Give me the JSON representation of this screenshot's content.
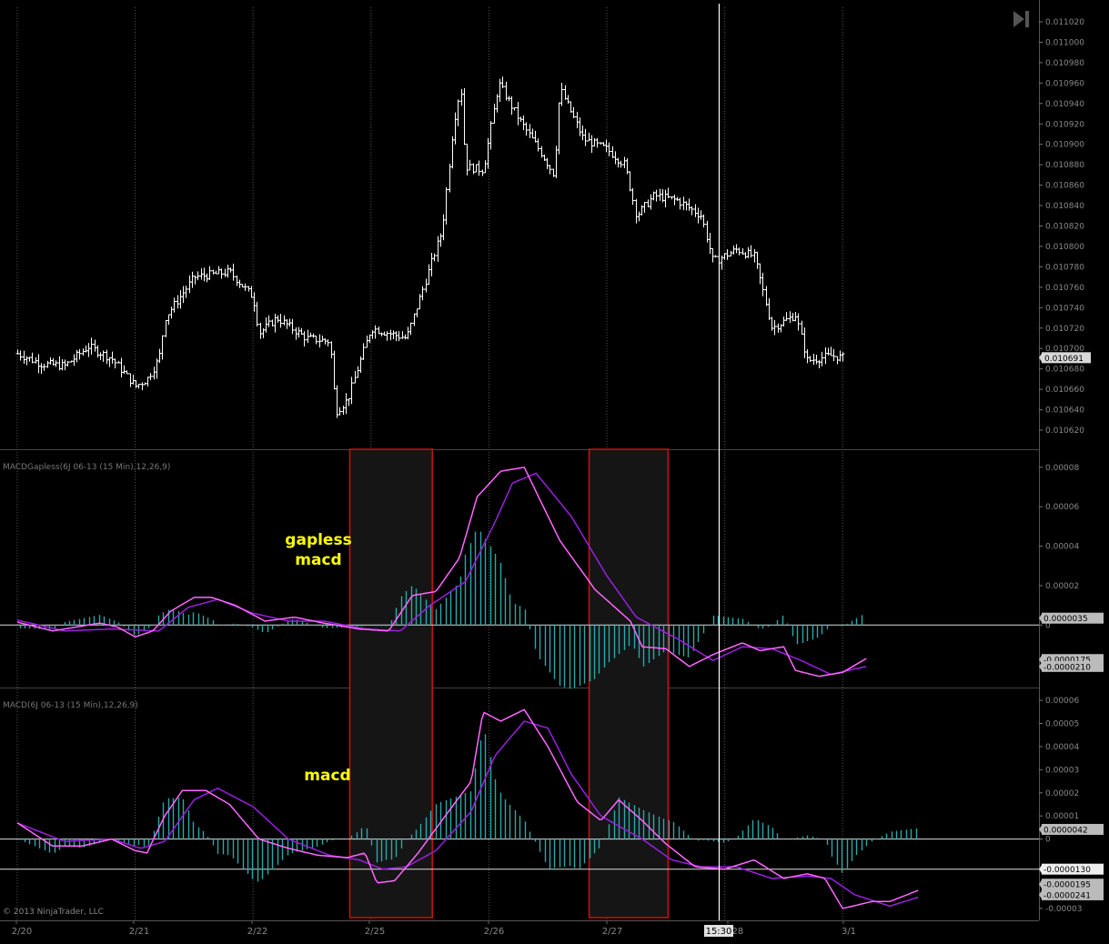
{
  "chart_data": [
    {
      "type": "line",
      "panel": "price",
      "title": "",
      "ylim": [
        0.0106,
        0.01103
      ],
      "yticks": [
        "0.011020",
        "0.011000",
        "0.010980",
        "0.010960",
        "0.010940",
        "0.010920",
        "0.010900",
        "0.010880",
        "0.010860",
        "0.010840",
        "0.010820",
        "0.010800",
        "0.010780",
        "0.010760",
        "0.010740",
        "0.010720",
        "0.010700",
        "0.010680",
        "0.010660",
        "0.010640",
        "0.010620"
      ],
      "last_price_label": "0.010691",
      "anchors": [
        {
          "t": 0.0,
          "p": 0.010695
        },
        {
          "t": 0.2,
          "p": 0.010685
        },
        {
          "t": 0.4,
          "p": 0.010683
        },
        {
          "t": 0.6,
          "p": 0.010702
        },
        {
          "t": 0.8,
          "p": 0.01069
        },
        {
          "t": 1.0,
          "p": 0.010663
        },
        {
          "t": 1.1,
          "p": 0.01067
        },
        {
          "t": 1.2,
          "p": 0.01069
        },
        {
          "t": 1.25,
          "p": 0.01073
        },
        {
          "t": 1.5,
          "p": 0.01077
        },
        {
          "t": 1.8,
          "p": 0.010775
        },
        {
          "t": 2.0,
          "p": 0.01075
        },
        {
          "t": 2.05,
          "p": 0.010715
        },
        {
          "t": 2.2,
          "p": 0.01073
        },
        {
          "t": 2.45,
          "p": 0.01071
        },
        {
          "t": 2.65,
          "p": 0.010707
        },
        {
          "t": 2.7,
          "p": 0.010638
        },
        {
          "t": 2.8,
          "p": 0.01065
        },
        {
          "t": 3.0,
          "p": 0.01072
        },
        {
          "t": 3.3,
          "p": 0.01071
        },
        {
          "t": 3.5,
          "p": 0.01078
        },
        {
          "t": 3.6,
          "p": 0.010815
        },
        {
          "t": 3.7,
          "p": 0.01092
        },
        {
          "t": 3.76,
          "p": 0.010958
        },
        {
          "t": 3.8,
          "p": 0.010878
        },
        {
          "t": 3.95,
          "p": 0.010875
        },
        {
          "t": 4.08,
          "p": 0.01096
        },
        {
          "t": 4.25,
          "p": 0.010925
        },
        {
          "t": 4.45,
          "p": 0.01089
        },
        {
          "t": 4.55,
          "p": 0.01087
        },
        {
          "t": 4.6,
          "p": 0.010955
        },
        {
          "t": 4.8,
          "p": 0.010905
        },
        {
          "t": 5.0,
          "p": 0.010895
        },
        {
          "t": 5.15,
          "p": 0.01088
        },
        {
          "t": 5.25,
          "p": 0.01083
        },
        {
          "t": 5.4,
          "p": 0.01085
        },
        {
          "t": 5.6,
          "p": 0.010845
        },
        {
          "t": 5.8,
          "p": 0.01083
        },
        {
          "t": 5.9,
          "p": 0.010785
        },
        {
          "t": 6.1,
          "p": 0.010797
        },
        {
          "t": 6.25,
          "p": 0.01079
        },
        {
          "t": 6.4,
          "p": 0.01072
        },
        {
          "t": 6.6,
          "p": 0.010733
        },
        {
          "t": 6.7,
          "p": 0.010688
        },
        {
          "t": 6.9,
          "p": 0.010693
        },
        {
          "t": 7.0,
          "p": 0.010691
        }
      ]
    },
    {
      "type": "line",
      "panel": "gapless",
      "title": "MACDGapless(6J 06-13 (15 Min),12,26,9)",
      "annotation": [
        "gapless",
        "macd"
      ],
      "ylim": [
        -2.8e-05,
        8.5e-05
      ],
      "yticks": [
        {
          "v": 8e-05,
          "label": "0.00008"
        },
        {
          "v": 6e-05,
          "label": "0.00006"
        },
        {
          "v": 4e-05,
          "label": "0.00004"
        },
        {
          "v": 2e-05,
          "label": "0.00002"
        },
        {
          "v": 0.0,
          "label": "0"
        }
      ],
      "reference_value": 0.0,
      "value_badges": [
        {
          "v": 3.5e-06,
          "label": "0.0000035"
        },
        {
          "v": -1.75e-05,
          "label": "-0.0000175"
        },
        {
          "v": -2.1e-05,
          "label": "-0.0000210"
        }
      ],
      "series": [
        {
          "color": "#ff66ff",
          "points": [
            [
              0,
              1.5e-06
            ],
            [
              0.3,
              -3e-06
            ],
            [
              0.5,
              -1e-06
            ],
            [
              0.7,
              1e-06
            ],
            [
              0.85,
              -1e-06
            ],
            [
              1.0,
              -6e-06
            ],
            [
              1.15,
              -3e-06
            ],
            [
              1.3,
              7e-06
            ],
            [
              1.5,
              1.4e-05
            ],
            [
              1.65,
              1.4e-05
            ],
            [
              1.85,
              1e-05
            ],
            [
              2.1,
              2e-06
            ],
            [
              2.35,
              4e-06
            ],
            [
              2.6,
              1e-06
            ],
            [
              2.9,
              -2e-06
            ],
            [
              3.15,
              -3e-06
            ],
            [
              3.35,
              1.5e-05
            ],
            [
              3.55,
              1.7e-05
            ],
            [
              3.75,
              3.4e-05
            ],
            [
              3.9,
              6.5e-05
            ],
            [
              4.1,
              7.8e-05
            ],
            [
              4.3,
              8e-05
            ],
            [
              4.6,
              4.3e-05
            ],
            [
              4.9,
              1.8e-05
            ],
            [
              5.2,
              2e-06
            ],
            [
              5.3,
              -1.1e-05
            ],
            [
              5.5,
              -1.2e-05
            ],
            [
              5.7,
              -2.1e-05
            ],
            [
              5.9,
              -1.5e-05
            ],
            [
              6.15,
              -9e-06
            ],
            [
              6.3,
              -1.3e-05
            ],
            [
              6.5,
              -1.1e-05
            ],
            [
              6.6,
              -2.3e-05
            ],
            [
              6.8,
              -2.6e-05
            ],
            [
              7.0,
              -2.4e-05
            ],
            [
              7.2,
              -1.7e-05
            ]
          ]
        },
        {
          "color": "#9a1fe0",
          "points": [
            [
              0,
              2.5e-06
            ],
            [
              0.4,
              -3e-06
            ],
            [
              0.8,
              -2e-06
            ],
            [
              1.2,
              -3e-06
            ],
            [
              1.45,
              9e-06
            ],
            [
              1.7,
              1.3e-05
            ],
            [
              2.0,
              6e-06
            ],
            [
              2.3,
              2e-06
            ],
            [
              2.6,
              2e-06
            ],
            [
              2.95,
              -2e-06
            ],
            [
              3.25,
              -3e-06
            ],
            [
              3.5,
              1e-05
            ],
            [
              3.8,
              2.2e-05
            ],
            [
              4.05,
              5.2e-05
            ],
            [
              4.2,
              7.2e-05
            ],
            [
              4.4,
              7.7e-05
            ],
            [
              4.7,
              5.5e-05
            ],
            [
              5.0,
              2.5e-05
            ],
            [
              5.25,
              4e-06
            ],
            [
              5.6,
              -7e-06
            ],
            [
              5.9,
              -1.8e-05
            ],
            [
              6.15,
              -1.1e-05
            ],
            [
              6.4,
              -1.2e-05
            ],
            [
              6.65,
              -1.8e-05
            ],
            [
              6.9,
              -2.5e-05
            ],
            [
              7.2,
              -2.1e-05
            ]
          ]
        }
      ]
    },
    {
      "type": "line",
      "panel": "macd",
      "title": "MACD(6J 06-13 (15 Min),12,26,9)",
      "annotation": [
        "macd"
      ],
      "ylim": [
        -3.2e-05,
        6.2e-05
      ],
      "yticks": [
        {
          "v": 6e-05,
          "label": "0.00006"
        },
        {
          "v": 5e-05,
          "label": "0.00005"
        },
        {
          "v": 4e-05,
          "label": "0.00004"
        },
        {
          "v": 3e-05,
          "label": "0.00003"
        },
        {
          "v": 2e-05,
          "label": "0.00002"
        },
        {
          "v": 1e-05,
          "label": "0.00001"
        },
        {
          "v": 0.0,
          "label": "0"
        },
        {
          "v": -3e-05,
          "label": "-0.00003"
        }
      ],
      "reference_value": 0.0,
      "reference_value_2": -1.3e-05,
      "value_badges": [
        {
          "v": 4.2e-06,
          "label": "0.0000042"
        },
        {
          "v": -1.3e-05,
          "label": "-0.0000130"
        },
        {
          "v": -1.95e-05,
          "label": "-0.0000195"
        },
        {
          "v": -2.41e-05,
          "label": "-0.0000241"
        }
      ],
      "series": [
        {
          "color": "#ff66ff",
          "points": [
            [
              0,
              7e-06
            ],
            [
              0.3,
              -3e-06
            ],
            [
              0.55,
              -3e-06
            ],
            [
              0.8,
              0.0
            ],
            [
              1.0,
              -5e-06
            ],
            [
              1.1,
              -6e-06
            ],
            [
              1.25,
              1e-05
            ],
            [
              1.4,
              2.1e-05
            ],
            [
              1.6,
              2.1e-05
            ],
            [
              1.8,
              1.5e-05
            ],
            [
              2.05,
              0.0
            ],
            [
              2.3,
              -4e-06
            ],
            [
              2.55,
              -7e-06
            ],
            [
              2.8,
              -8e-06
            ],
            [
              2.95,
              -6e-06
            ],
            [
              3.05,
              -1.9e-05
            ],
            [
              3.2,
              -1.8e-05
            ],
            [
              3.4,
              -6e-06
            ],
            [
              3.6,
              8e-06
            ],
            [
              3.85,
              2.5e-05
            ],
            [
              3.95,
              5.5e-05
            ],
            [
              4.1,
              5.1e-05
            ],
            [
              4.3,
              5.6e-05
            ],
            [
              4.5,
              4e-05
            ],
            [
              4.75,
              1.6e-05
            ],
            [
              4.95,
              8e-06
            ],
            [
              5.1,
              1.7e-05
            ],
            [
              5.3,
              8e-06
            ],
            [
              5.5,
              -2e-06
            ],
            [
              5.75,
              -1.2e-05
            ],
            [
              6.0,
              -1.3e-05
            ],
            [
              6.25,
              -9e-06
            ],
            [
              6.5,
              -1.7e-05
            ],
            [
              6.7,
              -1.5e-05
            ],
            [
              6.85,
              -1.7e-05
            ],
            [
              7.0,
              -3e-05
            ],
            [
              7.25,
              -2.7e-05
            ],
            [
              7.4,
              -2.7e-05
            ],
            [
              7.65,
              -2.2e-05
            ]
          ]
        },
        {
          "color": "#9a1fe0",
          "points": [
            [
              0,
              7e-06
            ],
            [
              0.4,
              -1e-06
            ],
            [
              0.8,
              0.0
            ],
            [
              1.05,
              -4e-06
            ],
            [
              1.25,
              -1e-06
            ],
            [
              1.5,
              1.7e-05
            ],
            [
              1.7,
              2.2e-05
            ],
            [
              2.0,
              1.4e-05
            ],
            [
              2.3,
              0.0
            ],
            [
              2.65,
              -7e-06
            ],
            [
              2.9,
              -9e-06
            ],
            [
              3.1,
              -1.3e-05
            ],
            [
              3.3,
              -1.2e-05
            ],
            [
              3.55,
              -5e-06
            ],
            [
              3.85,
              1.2e-05
            ],
            [
              4.05,
              3.6e-05
            ],
            [
              4.3,
              5.1e-05
            ],
            [
              4.5,
              4.8e-05
            ],
            [
              4.7,
              2.8e-05
            ],
            [
              4.95,
              1e-05
            ],
            [
              5.3,
              0.0
            ],
            [
              5.55,
              -9e-06
            ],
            [
              5.8,
              -1.2e-05
            ],
            [
              6.1,
              -1.2e-05
            ],
            [
              6.4,
              -1.7e-05
            ],
            [
              6.7,
              -1.6e-05
            ],
            [
              6.9,
              -1.7e-05
            ],
            [
              7.1,
              -2.4e-05
            ],
            [
              7.4,
              -2.9e-05
            ],
            [
              7.65,
              -2.5e-05
            ]
          ]
        }
      ]
    }
  ],
  "x_axis": {
    "date_labels": [
      "2/20",
      "2/21",
      "2/22",
      "2/25",
      "2/26",
      "2/27",
      "2/28",
      "3/1"
    ],
    "cursor_label": "15:30"
  },
  "highlight_boxes": [
    {
      "from": 2.82,
      "to": 3.52
    },
    {
      "from": 4.85,
      "to": 5.52
    }
  ],
  "colors": {
    "background": "#000000",
    "price_bars": "#ffffff",
    "histogram": "#2aa8a8",
    "box_border": "#cc1111",
    "annotation": "#ffff00",
    "macd_line": "#ff66ff",
    "signal_line": "#9a1fe0"
  },
  "copyright": "© 2013 NinjaTrader, LLC",
  "toolbar": {
    "scroll_end_icon": "skip-to-end-icon"
  }
}
